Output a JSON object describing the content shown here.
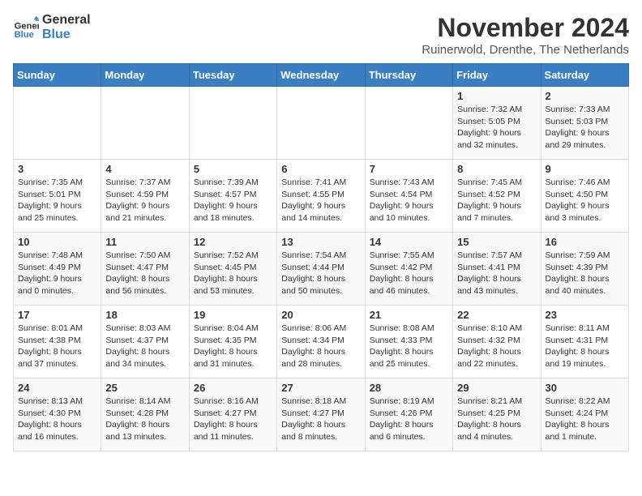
{
  "logo": {
    "line1": "General",
    "line2": "Blue"
  },
  "title": "November 2024",
  "subtitle": "Ruinerwold, Drenthe, The Netherlands",
  "weekdays": [
    "Sunday",
    "Monday",
    "Tuesday",
    "Wednesday",
    "Thursday",
    "Friday",
    "Saturday"
  ],
  "weeks": [
    [
      {
        "day": "",
        "info": ""
      },
      {
        "day": "",
        "info": ""
      },
      {
        "day": "",
        "info": ""
      },
      {
        "day": "",
        "info": ""
      },
      {
        "day": "",
        "info": ""
      },
      {
        "day": "1",
        "info": "Sunrise: 7:32 AM\nSunset: 5:05 PM\nDaylight: 9 hours and 32 minutes."
      },
      {
        "day": "2",
        "info": "Sunrise: 7:33 AM\nSunset: 5:03 PM\nDaylight: 9 hours and 29 minutes."
      }
    ],
    [
      {
        "day": "3",
        "info": "Sunrise: 7:35 AM\nSunset: 5:01 PM\nDaylight: 9 hours and 25 minutes."
      },
      {
        "day": "4",
        "info": "Sunrise: 7:37 AM\nSunset: 4:59 PM\nDaylight: 9 hours and 21 minutes."
      },
      {
        "day": "5",
        "info": "Sunrise: 7:39 AM\nSunset: 4:57 PM\nDaylight: 9 hours and 18 minutes."
      },
      {
        "day": "6",
        "info": "Sunrise: 7:41 AM\nSunset: 4:55 PM\nDaylight: 9 hours and 14 minutes."
      },
      {
        "day": "7",
        "info": "Sunrise: 7:43 AM\nSunset: 4:54 PM\nDaylight: 9 hours and 10 minutes."
      },
      {
        "day": "8",
        "info": "Sunrise: 7:45 AM\nSunset: 4:52 PM\nDaylight: 9 hours and 7 minutes."
      },
      {
        "day": "9",
        "info": "Sunrise: 7:46 AM\nSunset: 4:50 PM\nDaylight: 9 hours and 3 minutes."
      }
    ],
    [
      {
        "day": "10",
        "info": "Sunrise: 7:48 AM\nSunset: 4:49 PM\nDaylight: 9 hours and 0 minutes."
      },
      {
        "day": "11",
        "info": "Sunrise: 7:50 AM\nSunset: 4:47 PM\nDaylight: 8 hours and 56 minutes."
      },
      {
        "day": "12",
        "info": "Sunrise: 7:52 AM\nSunset: 4:45 PM\nDaylight: 8 hours and 53 minutes."
      },
      {
        "day": "13",
        "info": "Sunrise: 7:54 AM\nSunset: 4:44 PM\nDaylight: 8 hours and 50 minutes."
      },
      {
        "day": "14",
        "info": "Sunrise: 7:55 AM\nSunset: 4:42 PM\nDaylight: 8 hours and 46 minutes."
      },
      {
        "day": "15",
        "info": "Sunrise: 7:57 AM\nSunset: 4:41 PM\nDaylight: 8 hours and 43 minutes."
      },
      {
        "day": "16",
        "info": "Sunrise: 7:59 AM\nSunset: 4:39 PM\nDaylight: 8 hours and 40 minutes."
      }
    ],
    [
      {
        "day": "17",
        "info": "Sunrise: 8:01 AM\nSunset: 4:38 PM\nDaylight: 8 hours and 37 minutes."
      },
      {
        "day": "18",
        "info": "Sunrise: 8:03 AM\nSunset: 4:37 PM\nDaylight: 8 hours and 34 minutes."
      },
      {
        "day": "19",
        "info": "Sunrise: 8:04 AM\nSunset: 4:35 PM\nDaylight: 8 hours and 31 minutes."
      },
      {
        "day": "20",
        "info": "Sunrise: 8:06 AM\nSunset: 4:34 PM\nDaylight: 8 hours and 28 minutes."
      },
      {
        "day": "21",
        "info": "Sunrise: 8:08 AM\nSunset: 4:33 PM\nDaylight: 8 hours and 25 minutes."
      },
      {
        "day": "22",
        "info": "Sunrise: 8:10 AM\nSunset: 4:32 PM\nDaylight: 8 hours and 22 minutes."
      },
      {
        "day": "23",
        "info": "Sunrise: 8:11 AM\nSunset: 4:31 PM\nDaylight: 8 hours and 19 minutes."
      }
    ],
    [
      {
        "day": "24",
        "info": "Sunrise: 8:13 AM\nSunset: 4:30 PM\nDaylight: 8 hours and 16 minutes."
      },
      {
        "day": "25",
        "info": "Sunrise: 8:14 AM\nSunset: 4:28 PM\nDaylight: 8 hours and 13 minutes."
      },
      {
        "day": "26",
        "info": "Sunrise: 8:16 AM\nSunset: 4:27 PM\nDaylight: 8 hours and 11 minutes."
      },
      {
        "day": "27",
        "info": "Sunrise: 8:18 AM\nSunset: 4:27 PM\nDaylight: 8 hours and 8 minutes."
      },
      {
        "day": "28",
        "info": "Sunrise: 8:19 AM\nSunset: 4:26 PM\nDaylight: 8 hours and 6 minutes."
      },
      {
        "day": "29",
        "info": "Sunrise: 8:21 AM\nSunset: 4:25 PM\nDaylight: 8 hours and 4 minutes."
      },
      {
        "day": "30",
        "info": "Sunrise: 8:22 AM\nSunset: 4:24 PM\nDaylight: 8 hours and 1 minute."
      }
    ]
  ]
}
